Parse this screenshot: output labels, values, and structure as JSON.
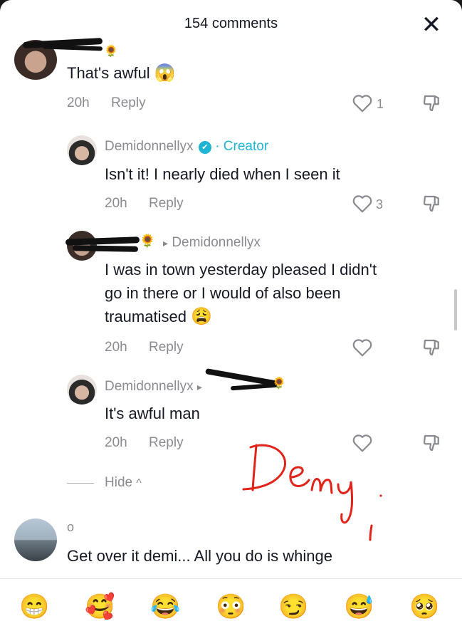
{
  "header": {
    "title": "154 comments",
    "close_glyph": "✕"
  },
  "comments": [
    {
      "name": "",
      "badge_emoji": "🌻",
      "text": "That's awful",
      "text_emoji": "😱",
      "time": "20h",
      "reply_label": "Reply",
      "likes": "1"
    },
    {
      "name": "Demidonnellyx",
      "creator_check": "✔",
      "separator": "·",
      "creator_label": "Creator",
      "text": "Isn't it! I nearly died when I seen it",
      "time": "20h",
      "reply_label": "Reply",
      "likes": "3"
    },
    {
      "name": "",
      "badge_emoji": "🌻",
      "reply_to_arrow": "▸",
      "reply_to": "Demidonnellyx",
      "text_lines": [
        "I was in town yesterday pleased I didn't",
        "go in there or I would of also been",
        "traumatised"
      ],
      "text_emoji": "😩",
      "time": "20h",
      "reply_label": "Reply",
      "likes": ""
    },
    {
      "name": "Demidonnellyx",
      "reply_to_arrow": "▸",
      "badge_emoji": "🌻",
      "text": "It's awful man",
      "time": "20h",
      "reply_label": "Reply",
      "likes": ""
    },
    {
      "name": "o",
      "text": "Get over it demi... All you do is whinge"
    }
  ],
  "hide": {
    "label": "Hide",
    "chevron": "^"
  },
  "annotation": {
    "text": "Demi",
    "color": "#e2231a"
  },
  "emoji_bar": [
    "😁",
    "🥰",
    "😂",
    "😳",
    "😏",
    "😅",
    "🥺"
  ],
  "colors": {
    "accent_creator": "#20b4d4",
    "secondary_text": "#8a8b91",
    "primary_text": "#161823"
  }
}
